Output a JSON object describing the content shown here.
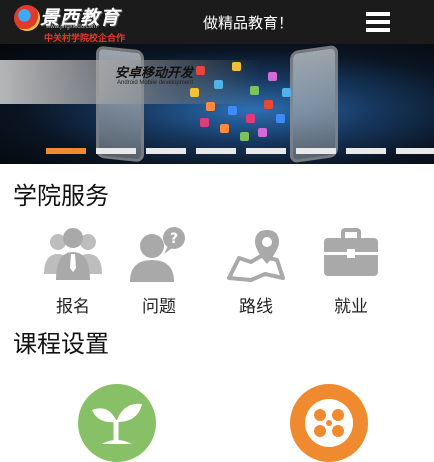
{
  "header": {
    "logo_text": "景西教育",
    "logo_url": "www.jingxiedu.com",
    "logo_sub": "中关村学院校企合作",
    "slogan": "做精品教育！",
    "menu_icon": "hamburger-menu-icon"
  },
  "banner": {
    "title": "安卓移动开发",
    "subtitle": "Android Mobile development",
    "slide_count": 8,
    "active_slide": 1,
    "colors": {
      "indicator_active": "#f08a2e",
      "indicator_inactive": "#e9e9e9"
    }
  },
  "services": {
    "title": "学院服务",
    "items": [
      {
        "label": "报名",
        "icon": "people-group-icon"
      },
      {
        "label": "问题",
        "icon": "person-question-icon"
      },
      {
        "label": "路线",
        "icon": "map-pin-icon"
      },
      {
        "label": "就业",
        "icon": "briefcase-icon"
      }
    ],
    "icon_color": "#a9a9a9"
  },
  "courses": {
    "title": "课程设置",
    "items": [
      {
        "icon": "sprout-icon",
        "color": "#87c066"
      },
      {
        "icon": "film-reel-icon",
        "color": "#f08a2e"
      }
    ]
  }
}
